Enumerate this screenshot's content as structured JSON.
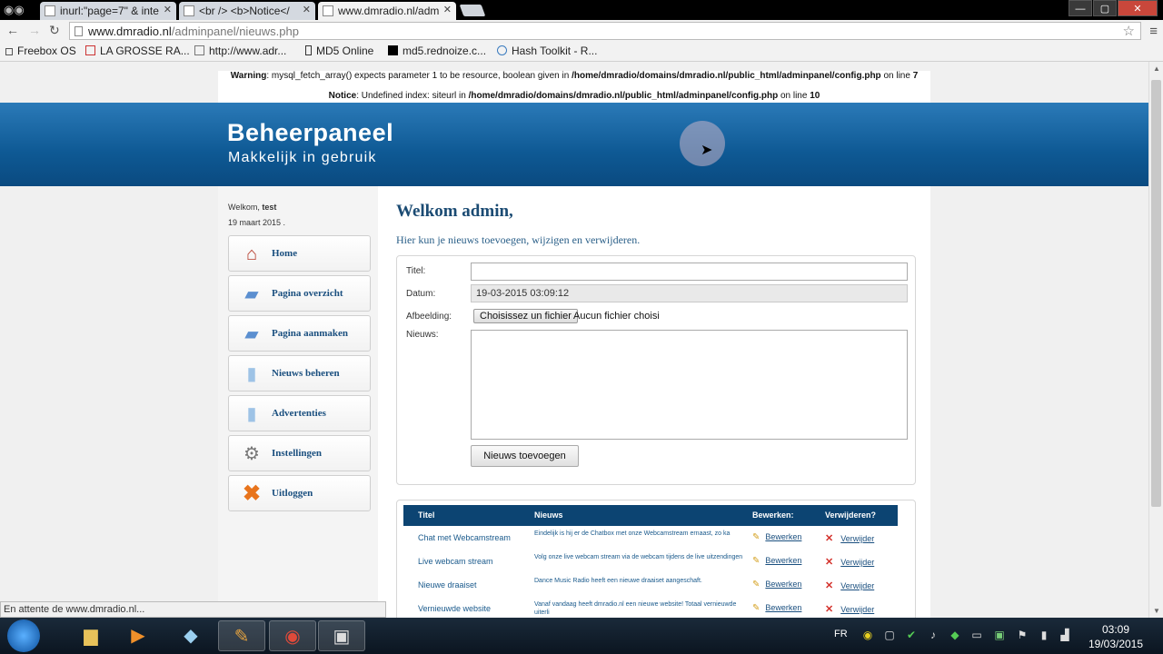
{
  "browser": {
    "tabs": [
      {
        "label": "inurl:\"page=7\" & inte",
        "active": false
      },
      {
        "label": "<br /> <b>Notice</",
        "active": false
      },
      {
        "label": "www.dmradio.nl/adm",
        "active": true
      }
    ],
    "url_domain": "www.dmradio.nl",
    "url_path": "/adminpanel/nieuws.php",
    "bookmarks": [
      "Freebox OS",
      "LA GROSSE RA...",
      "http://www.adr...",
      "MD5 Online",
      "md5.rednoize.c...",
      "Hash Toolkit - R..."
    ],
    "status": "En attente de www.dmradio.nl..."
  },
  "warnings": {
    "w1_label": "Warning",
    "w1_text": ": mysql_fetch_array() expects parameter 1 to be resource, boolean given in ",
    "w1_path": "/home/dmradio/domains/dmradio.nl/public_html/adminpanel/config.php",
    "w1_on": " on line ",
    "w1_line": "7",
    "w2_label": "Notice",
    "w2_text": ": Undefined index: siteurl in ",
    "w2_path": "/home/dmradio/domains/dmradio.nl/public_html/adminpanel/config.php",
    "w2_on": " on line ",
    "w2_line": "10"
  },
  "header": {
    "title": "Beheerpaneel",
    "subtitle": "Makkelijk in gebruik"
  },
  "sidebar": {
    "welcome_prefix": "Welkom, ",
    "username": "test",
    "date": "19 maart 2015 .",
    "items": [
      {
        "label": "Home"
      },
      {
        "label": "Pagina overzicht"
      },
      {
        "label": "Pagina aanmaken"
      },
      {
        "label": "Nieuws beheren"
      },
      {
        "label": "Advertenties"
      },
      {
        "label": "Instellingen"
      },
      {
        "label": "Uitloggen"
      }
    ]
  },
  "main": {
    "heading": "Welkom admin,",
    "intro": "Hier kun je nieuws toevoegen, wijzigen en verwijderen.",
    "form": {
      "title_label": "Titel:",
      "title_value": "",
      "date_label": "Datum:",
      "date_value": "19-03-2015 03:09:12",
      "image_label": "Afbeelding:",
      "file_button": "Choisissez un fichier",
      "file_text": "Aucun fichier choisi",
      "news_label": "Nieuws:",
      "submit": "Nieuws toevoegen"
    },
    "table": {
      "headers": [
        "Titel",
        "Nieuws",
        "Bewerken:",
        "Verwijderen?"
      ],
      "rows": [
        {
          "title": "Chat met Webcamstream",
          "news": "Eindelijk is hij er de Chatbox met onze Webcamstream ernaast, zo ka",
          "edit": "Bewerken",
          "delete": "Verwijder"
        },
        {
          "title": "Live webcam stream",
          "news": "Volg onze live webcam stream via de webcam tijdens de live uitzendingen",
          "edit": "Bewerken",
          "delete": "Verwijder"
        },
        {
          "title": "Nieuwe draaiset",
          "news": "Dance Music Radio heeft een nieuwe draaiset aangeschaft.",
          "edit": "Bewerken",
          "delete": "Verwijder"
        },
        {
          "title": "Vernieuwde website",
          "news": "Vanaf vandaag heeft dmradio.nl een nieuwe website! Totaal vernieuwde uiterli",
          "edit": "Bewerken",
          "delete": "Verwijder"
        }
      ]
    }
  },
  "taskbar": {
    "lang": "FR",
    "time": "03:09",
    "date": "19/03/2015"
  }
}
